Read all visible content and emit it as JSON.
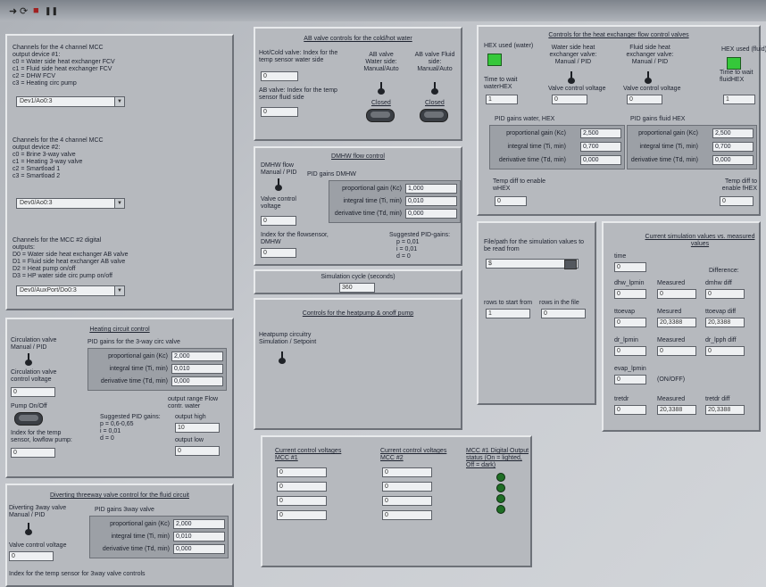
{
  "toolbar": {
    "run": "➜",
    "run_cont": "⟳",
    "stop": "■",
    "pause": "❚❚"
  },
  "channels_panel": {
    "mcc1": {
      "heading": "Channels for the 4 channel MCC",
      "device": "output device #1:",
      "lines": [
        "c0 = Water side heat exchanger FCV",
        "c1 = Fluid side heat exchanger FCV",
        "c2 = DHW FCV",
        "c3 = Heating circ pump"
      ],
      "select": "Dev1/Ao0:3"
    },
    "mcc2": {
      "heading": "Channels for the 4 channel MCC",
      "device": "output device #2:",
      "lines": [
        "c0 = Brine 3-way valve",
        "c1 = Heating 3-way valve",
        "c2 = Smartload 1",
        "c3 = Smartload 2"
      ],
      "select": "Dev0/Ao0:3"
    },
    "digital": {
      "heading": "Channels for the MCC #2 digital",
      "device": "outputs:",
      "lines": [
        "D0 = Water side heat exchanger AB valve",
        "D1 = Fluid side heat exchanger AB valve",
        "D2 = Heat pump on/off",
        "D3 = HP water side circ pump on/off"
      ],
      "select": "Dev0/AuxPort/Do0:3"
    }
  },
  "heating": {
    "title": "Heating circuit control",
    "circ_mode": "Circulation valve Manual / PID",
    "pid_title": "PID gains for the 3-way circ valve",
    "kc_label": "proportional gain (Kc)",
    "kc": "2,000",
    "ti_label": "integral time (Ti, min)",
    "ti": "0,010",
    "td_label": "derivative time (Td, min)",
    "td": "0,000",
    "voltage_label": "Circulation valve control voltage",
    "voltage": "0",
    "pump_label": "Pump On/Off",
    "suggested": "Suggested PID gains:",
    "p": "p = 0,6-0,65",
    "i": "i = 0,01",
    "d": "d = 0",
    "range_label": "output range Flow contr. water",
    "high_label": "output high",
    "high": "10",
    "low_label": "output low",
    "low": "0",
    "index_label": "Index for the temp sensor, lowflow pump:",
    "index": "0"
  },
  "diverting": {
    "title": "Diverting threeway valve control for the fluid circuit",
    "mode": "Diverting 3way valve Manual / PID",
    "pid_title": "PID gains 3way valve",
    "kc_label": "proportional gain (Kc)",
    "kc": "2,000",
    "ti_label": "integral time (Ti, min)",
    "ti": "0,010",
    "td_label": "derivative time (Td, min)",
    "td": "0,000",
    "voltage_label": "Valve control voltage",
    "voltage": "0",
    "index_label": "Index for the temp sensor for 3way valve controls"
  },
  "ab_valve": {
    "title": "AB valve controls for the cold/hot water",
    "hotcold_label": "Hot/Cold valve: Index for the temp sensor water side",
    "hotcold": "0",
    "ab_label": "AB valve: Index for the temp sensor fluid side",
    "ab": "0",
    "water_label": "AB valve Water side: Manual/Auto",
    "fluid_label": "AB valve Fluid side: Manual/Auto",
    "closed1": "Closed",
    "closed2": "Closed"
  },
  "dmhw": {
    "title": "DMHW flow control",
    "mode": "DMHW flow Manual / PID",
    "pid_title": "PID gains DMHW",
    "kc_label": "proportional gain (Kc)",
    "kc": "1,000",
    "ti_label": "integral time (Ti, min)",
    "ti": "0,010",
    "td_label": "derivative time (Td, min)",
    "td": "0,000",
    "voltage_label": "Valve control voltage",
    "voltage": "0",
    "index_label": "Index for the flowsensor, DMHW",
    "index": "0",
    "suggested": "Suggested PID-gains:",
    "p": "p = 0,01",
    "i": "i = 0,01",
    "d": "d = 0"
  },
  "simulation": {
    "label": "Simulation cycle (seconds)",
    "value": "360"
  },
  "heatpump": {
    "title": "Controls for the heatpump & onoff pump",
    "label": "Heatpump circuitry Simulation / Setpoint"
  },
  "voltages": {
    "mcc1_title": "Current control voltages MCC #1",
    "mcc2_title": "Current control voltages MCC #2",
    "digital_title": "MCC #1 Digital Output status (On = lighted, Off = dark)",
    "mcc1": [
      "0",
      "0",
      "0",
      "0"
    ],
    "mcc2": [
      "0",
      "0",
      "0",
      "0"
    ]
  },
  "hex": {
    "title": "Controls for the heat exchanger flow control valves",
    "water_used": "HEX used (water)",
    "fluid_used": "HEX used (fluid)",
    "water_mode": "Water side heat exchanger valve: Manual / PID",
    "fluid_mode": "Fluid side heat exchanger valve: Manual / PID",
    "wait_water_label": "Time to wait waterHEX",
    "wait_water": "1",
    "wait_fluid_label": "Time to wait fluidHEX",
    "wait_fluid": "1",
    "valve_voltage1": "Valve control voltage",
    "v1": "0",
    "valve_voltage2": "Valve control voltage",
    "v2": "0",
    "pid_water_title": "PID gains water, HEX",
    "pid_fluid_title": "PID gains fluid HEX",
    "kc_label": "proportional gain (Kc)",
    "kc_w": "2,500",
    "kc_f": "2,500",
    "ti_label": "integral time (Ti, min)",
    "ti_w": "0,700",
    "ti_f": "0,700",
    "td_label": "derivative time (Td, min)",
    "td_w": "0,000",
    "td_f": "0,000",
    "temp_water_label": "Temp diff to enable wHEX",
    "temp_water": "0",
    "temp_fluid_label": "Temp diff to enable fHEX",
    "temp_fluid": "0"
  },
  "file": {
    "path_label": "File/path for the simulation values to be read from",
    "path": "$",
    "rows_label": "rows to start from",
    "rows": "1",
    "rows_file_label": "rows in the file",
    "rows_file": "0"
  },
  "sim_values": {
    "title": "Current simulation values vs. measured values",
    "time_label": "time",
    "time": "0",
    "difference": "Difference:",
    "rows": [
      {
        "a_label": "dhw_lpmin",
        "a": "0",
        "b_label": "Measured",
        "b": "0",
        "c_label": "dmhw diff",
        "c": "0"
      },
      {
        "a_label": "ttoevap",
        "a": "0",
        "b_label": "Mesured",
        "b": "20,3388",
        "c_label": "ttoevap diff",
        "c": "20,3388"
      },
      {
        "a_label": "dr_lpmin",
        "a": "0",
        "b_label": "Measured",
        "b": "0",
        "c_label": "dr_lpph diff",
        "c": "0"
      }
    ],
    "evap_label": "evap_lpmin",
    "evap": "0",
    "onoff": "(ON/OFF)",
    "tretdr_label": "tretdr",
    "tretdr": "0",
    "meas_label": "Measured",
    "meas": "20,3388",
    "tretdr_diff_label": "tretdr diff",
    "tretdr_diff": "20,3388"
  }
}
